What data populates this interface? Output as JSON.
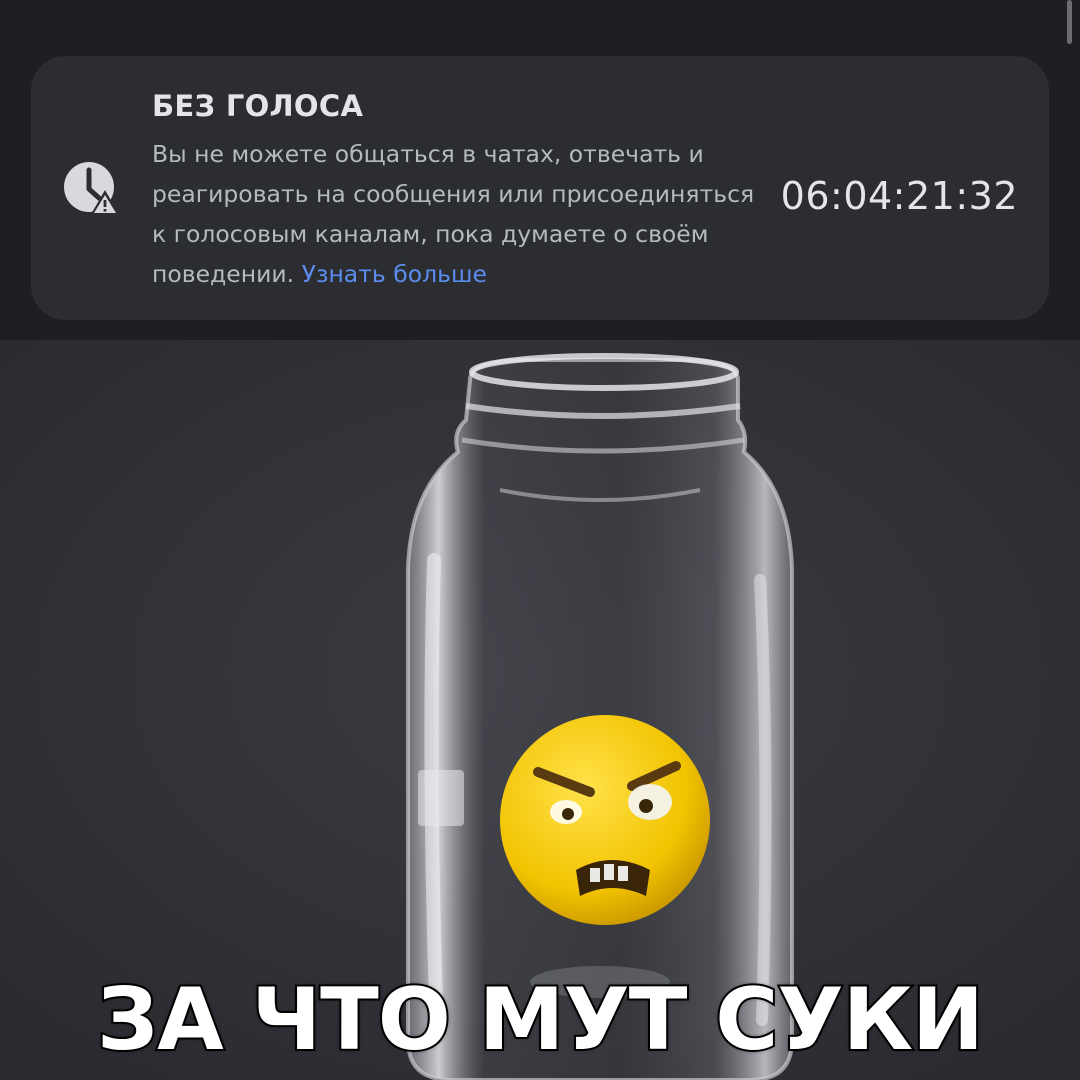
{
  "mute_notice": {
    "title": "БЕЗ ГОЛОСА",
    "message": "Вы не можете общаться в чатах, отвечать и реагировать на сообщения или присоединяться к голосовым каналам, пока думаете о своём поведении.",
    "learn_more_label": "Узнать больше",
    "timer": "06:04:21:32",
    "icon": "clock-warning-icon"
  },
  "meme": {
    "caption": "ЗА ЧТО МУТ СУКИ",
    "image": "angry-emoji-in-glass-jar"
  },
  "colors": {
    "background": "#1e1f23",
    "card": "#2b2d31",
    "title": "#e3e5e8",
    "body_text": "#b5bac1",
    "link": "#5b8def",
    "meme_background": "#2e2f35",
    "emoji": "#f2c300"
  }
}
